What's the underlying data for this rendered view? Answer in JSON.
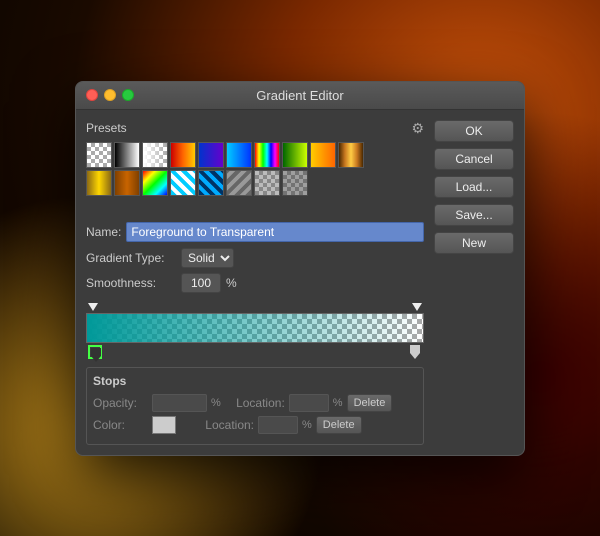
{
  "window": {
    "title": "Gradient Editor"
  },
  "traffic_lights": {
    "close_label": "close",
    "min_label": "minimize",
    "max_label": "maximize"
  },
  "presets": {
    "label": "Presets",
    "gear_symbol": "⚙"
  },
  "buttons": {
    "ok": "OK",
    "cancel": "Cancel",
    "load": "Load...",
    "save": "Save...",
    "new": "New",
    "delete_opacity": "Delete",
    "delete_color": "Delete"
  },
  "name": {
    "label": "Name:",
    "value": "Foreground to Transparent"
  },
  "gradient_type": {
    "label": "Gradient Type:",
    "value": "Solid"
  },
  "smoothness": {
    "label": "Smoothness:",
    "value": "100",
    "unit": "%"
  },
  "stops": {
    "title": "Stops",
    "opacity_label": "Opacity:",
    "opacity_value": "",
    "opacity_unit": "%",
    "color_label": "Color:",
    "location_label": "Location:",
    "location_unit": "%"
  }
}
